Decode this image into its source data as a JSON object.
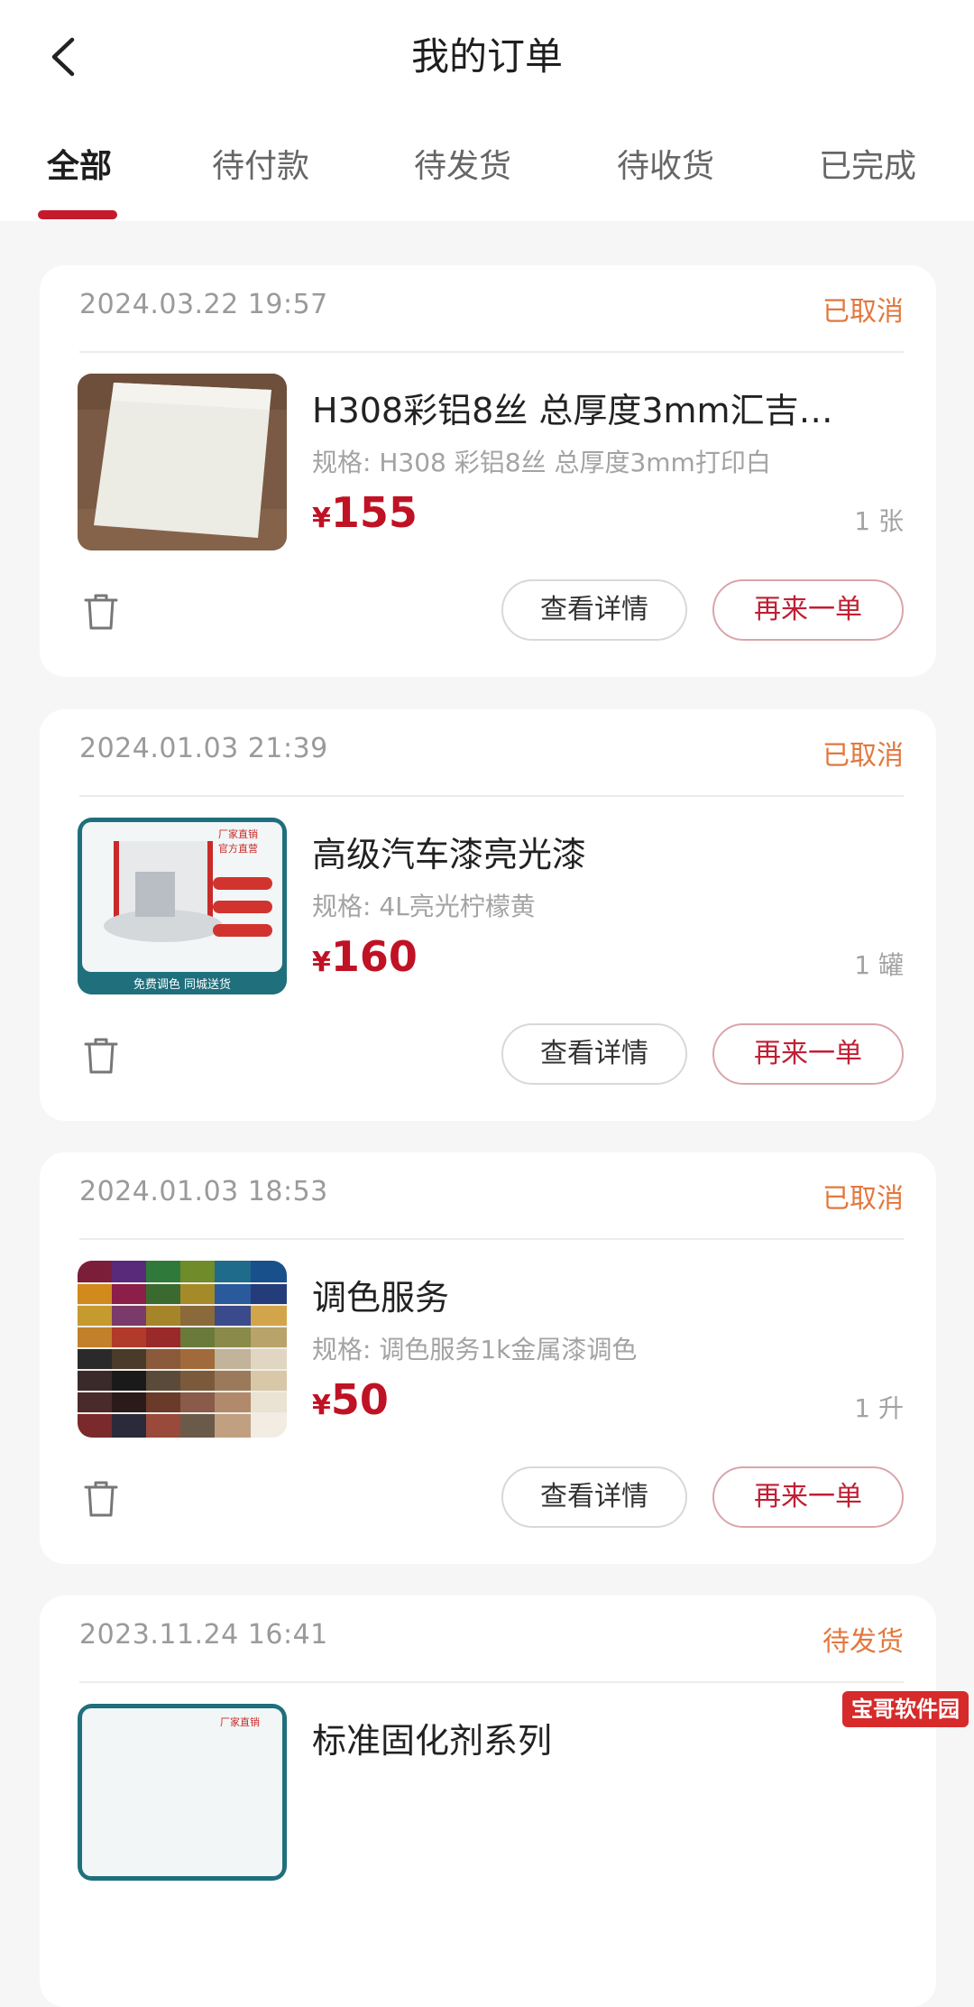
{
  "header": {
    "title": "我的订单",
    "back_icon": "back-arrow-icon"
  },
  "tabs": [
    {
      "label": "全部",
      "active": true
    },
    {
      "label": "待付款",
      "active": false
    },
    {
      "label": "待发货",
      "active": false
    },
    {
      "label": "待收货",
      "active": false
    },
    {
      "label": "已完成",
      "active": false
    }
  ],
  "orders": [
    {
      "date": "2024.03.22 19:57",
      "status": "已取消",
      "name": "H308彩铝8丝 总厚度3mm汇吉…",
      "spec": "规格: H308 彩铝8丝 总厚度3mm打印白",
      "currency": "¥",
      "price": "155",
      "qty": "1 张",
      "detail_label": "查看详情",
      "reorder_label": "再来一单"
    },
    {
      "date": "2024.01.03 21:39",
      "status": "已取消",
      "name": "高级汽车漆亮光漆",
      "spec": "规格: 4L亮光柠檬黄",
      "currency": "¥",
      "price": "160",
      "qty": "1 罐",
      "detail_label": "查看详情",
      "reorder_label": "再来一单",
      "thumb_texts": {
        "badge": "厂家直销 官方直营",
        "footer": "免费调色 同城送货"
      }
    },
    {
      "date": "2024.01.03 18:53",
      "status": "已取消",
      "name": "调色服务",
      "spec": "规格: 调色服务1k金属漆调色",
      "currency": "¥",
      "price": "50",
      "qty": "1 升",
      "detail_label": "查看详情",
      "reorder_label": "再来一单"
    },
    {
      "date": "2023.11.24 16:41",
      "status": "待发货",
      "name": "标准固化剂系列",
      "thumb_texts": {
        "badge": "厂家直销"
      }
    }
  ],
  "watermark": "宝哥软件园",
  "colors": {
    "accent": "#c51a2c",
    "price": "#c01225",
    "status": "#e2783e",
    "background": "#f6f6f6"
  }
}
